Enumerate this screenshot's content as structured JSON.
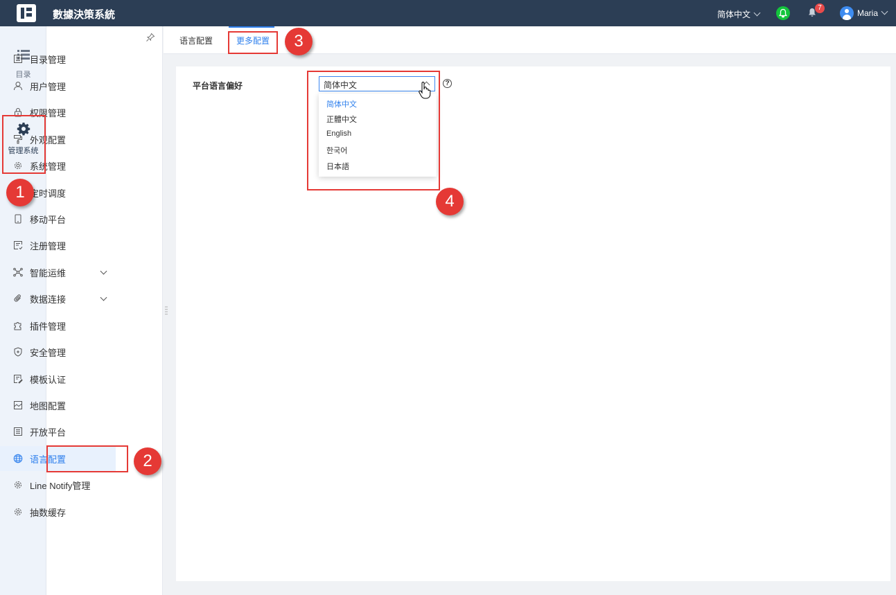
{
  "header": {
    "app_title": "數據決策系統",
    "language": "简体中文",
    "notification_count": "7",
    "username": "Maria"
  },
  "rail": {
    "items": [
      {
        "label": "目录"
      },
      {
        "label": "管理系统"
      }
    ]
  },
  "sidebar": {
    "items": [
      {
        "label": "目录管理",
        "icon": "catalog-icon"
      },
      {
        "label": "用户管理",
        "icon": "user-icon"
      },
      {
        "label": "权限管理",
        "icon": "lock-icon"
      },
      {
        "label": "外观配置",
        "icon": "paint-roller-icon"
      },
      {
        "label": "系统管理",
        "icon": "gear-icon"
      },
      {
        "label": "定时调度",
        "icon": "timer-icon"
      },
      {
        "label": "移动平台",
        "icon": "mobile-icon"
      },
      {
        "label": "注册管理",
        "icon": "register-icon"
      },
      {
        "label": "智能运维",
        "icon": "network-icon"
      },
      {
        "label": "数据连接",
        "icon": "paperclip-icon"
      },
      {
        "label": "插件管理",
        "icon": "puzzle-icon"
      },
      {
        "label": "安全管理",
        "icon": "shield-icon"
      },
      {
        "label": "模板认证",
        "icon": "template-icon"
      },
      {
        "label": "地图配置",
        "icon": "map-icon"
      },
      {
        "label": "开放平台",
        "icon": "list-icon"
      },
      {
        "label": "语言配置",
        "icon": "globe-icon"
      },
      {
        "label": "Line Notify管理",
        "icon": "gear-icon"
      },
      {
        "label": "抽数缓存",
        "icon": "gear-icon"
      }
    ]
  },
  "tabs": [
    {
      "label": "语言配置"
    },
    {
      "label": "更多配置"
    }
  ],
  "settings": {
    "field_label": "平台语言偏好",
    "selected_value": "简体中文",
    "help_glyph": "?",
    "options": [
      "简体中文",
      "正體中文",
      "English",
      "한국어",
      "日本語"
    ]
  },
  "annotations": [
    "1",
    "2",
    "3",
    "4"
  ],
  "colors": {
    "topbar": "#2c3e55",
    "accent": "#2f80ed",
    "annotation_red": "#e53935"
  }
}
